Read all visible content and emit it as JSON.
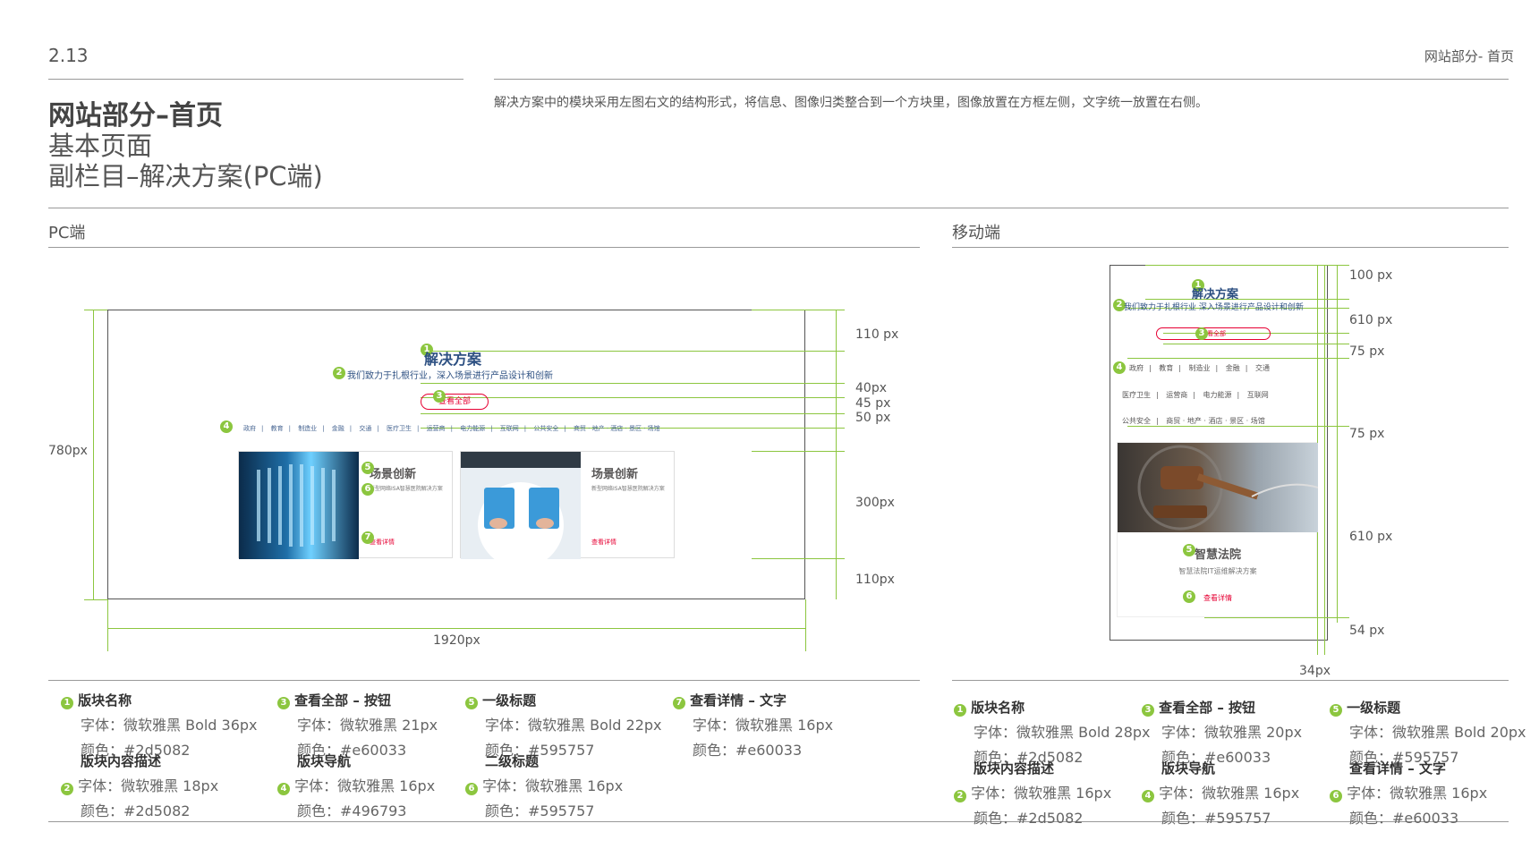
{
  "page_number": "2.13",
  "header_right": "网站部分- 首页",
  "title": {
    "main": "网站部分–首页",
    "line2": "基本页面",
    "line3": "副栏目–解决方案(PC端)"
  },
  "description": "解决方案中的模块采用左图右文的结构形式，将信息、图像归类整合到一个方块里，图像放置在方框左侧，文字统一放置在右侧。",
  "pc": {
    "section_label": "PC端",
    "width_label": "1920px",
    "height_label": "780px",
    "dims": [
      "110 px",
      "40px",
      "45 px",
      "50 px",
      "300px",
      "110px"
    ],
    "mock": {
      "title": "解决方案",
      "subtitle": "我们致力于扎根行业，深入场景进行产品设计和创新",
      "view_all": "查看全部",
      "nav": [
        "政府",
        "教育",
        "制造业",
        "金融",
        "交通",
        "医疗卫生",
        "运营商",
        "电力能源",
        "互联网",
        "公共安全",
        "商贸 · 地产 · 酒店 · 景区 · 场馆"
      ],
      "cards": [
        {
          "title": "场景创新",
          "desc": "新型网络ISA智慧医院解决方案",
          "link": "查看详情"
        },
        {
          "title": "场景创新",
          "desc": "新型网络ISA智慧医院解决方案",
          "link": "查看详情"
        }
      ]
    }
  },
  "mobile": {
    "section_label": "移动端",
    "width_label": "34px",
    "dims": [
      "100  px",
      "610 px",
      "75 px",
      "75 px",
      "610 px",
      "54 px"
    ],
    "mock": {
      "title": "解决方案",
      "subtitle": "我们致力于扎根行业 深入场景进行产品设计和创新",
      "view_all": "查看全部",
      "nav_rows": [
        [
          "政府",
          "教育",
          "制造业",
          "金融",
          "交通"
        ],
        [
          "医疗卫生",
          "运营商",
          "电力能源",
          "互联网"
        ],
        [
          "公共安全",
          "商贸 · 地产 · 酒店 · 景区 · 场馆"
        ]
      ],
      "card_title": "智慧法院",
      "card_desc": "智慧法院IT运维解决方案",
      "card_link": "查看详情"
    }
  },
  "pc_specs": [
    {
      "n": "1",
      "title": "版块名称",
      "lines": [
        "字体：微软雅黑 Bold   36px",
        "颜色：#2d5082"
      ]
    },
    {
      "n": "2",
      "title": "版块内容描述",
      "lines": [
        "字体：微软雅黑    18px",
        "颜色：#2d5082"
      ]
    },
    {
      "n": "3",
      "title": "查看全部 – 按钮",
      "lines": [
        "字体：微软雅黑    21px",
        "颜色：#e60033"
      ]
    },
    {
      "n": "4",
      "title": "版块导航",
      "lines": [
        "字体：微软雅黑    16px",
        "颜色：#496793"
      ]
    },
    {
      "n": "5",
      "title": "一级标题",
      "lines": [
        "字体：微软雅黑 Bold   22px",
        "颜色：#595757"
      ]
    },
    {
      "n": "6",
      "title": "二级标题",
      "lines": [
        "字体：微软雅黑    16px",
        "颜色：#595757"
      ]
    },
    {
      "n": "7",
      "title": "查看详情 – 文字",
      "lines": [
        "字体：微软雅黑    16px",
        "颜色：#e60033"
      ]
    }
  ],
  "mobile_specs": [
    {
      "n": "1",
      "title": "版块名称",
      "lines": [
        "字体：微软雅黑 Bold  28px",
        "颜色：#2d5082"
      ]
    },
    {
      "n": "2",
      "title": "版块内容描述",
      "lines": [
        "字体：微软雅黑   16px",
        "颜色：#2d5082"
      ]
    },
    {
      "n": "3",
      "title": "查看全部 – 按钮",
      "lines": [
        "字体：微软雅黑   20px",
        "颜色：#e60033"
      ]
    },
    {
      "n": "4",
      "title": "版块导航",
      "lines": [
        "字体：微软雅黑   16px",
        "颜色：#595757"
      ]
    },
    {
      "n": "5",
      "title": "一级标题",
      "lines": [
        "字体：微软雅黑 Bold  20px",
        "颜色：#595757"
      ]
    },
    {
      "n": "6",
      "title": "查看详情 – 文字",
      "lines": [
        "字体：微软雅黑   16px",
        "颜色：#e60033"
      ]
    }
  ],
  "colors": {
    "accent_green": "#8cc63f",
    "brand_blue": "#2d5082",
    "red": "#e60033"
  }
}
